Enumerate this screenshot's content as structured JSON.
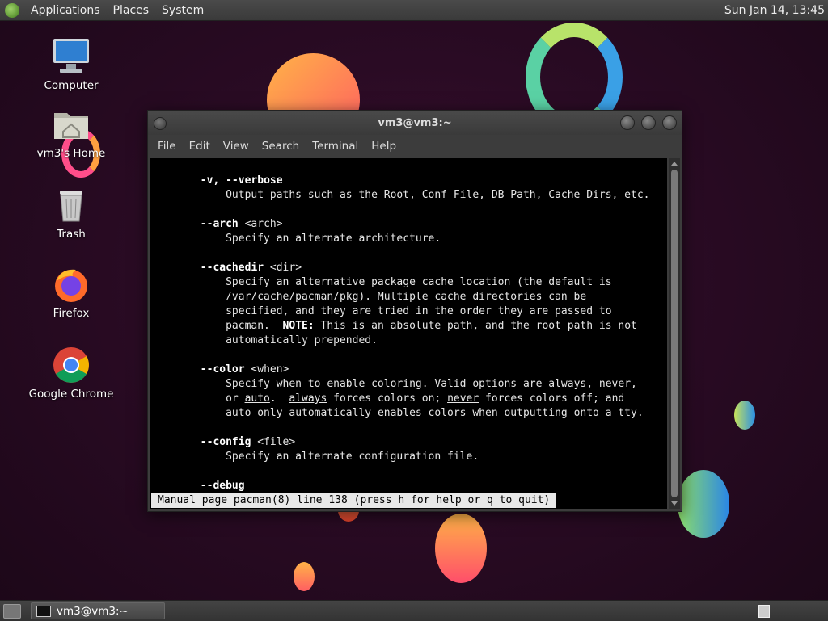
{
  "top_panel": {
    "menu": [
      "Applications",
      "Places",
      "System"
    ],
    "clock": "Sun Jan 14, 13:45"
  },
  "desktop_icons": [
    {
      "label": "Computer",
      "icon": "computer-icon"
    },
    {
      "label": "vm3's Home",
      "icon": "home-folder-icon"
    },
    {
      "label": "Trash",
      "icon": "trash-icon"
    },
    {
      "label": "Firefox",
      "icon": "firefox-icon"
    },
    {
      "label": "Google Chrome",
      "icon": "chrome-icon"
    }
  ],
  "terminal": {
    "title": "vm3@vm3:~",
    "menu": [
      "File",
      "Edit",
      "View",
      "Search",
      "Terminal",
      "Help"
    ],
    "lines": [
      [
        {
          "t": "       "
        },
        {
          "t": "-v, --verbose",
          "c": "b"
        }
      ],
      [
        {
          "t": "           Output paths such as the Root, Conf File, DB Path, Cache Dirs, etc."
        }
      ],
      [
        {
          "t": ""
        }
      ],
      [
        {
          "t": "       "
        },
        {
          "t": "--arch",
          "c": "b"
        },
        {
          "t": " <arch>"
        }
      ],
      [
        {
          "t": "           Specify an alternate architecture."
        }
      ],
      [
        {
          "t": ""
        }
      ],
      [
        {
          "t": "       "
        },
        {
          "t": "--cachedir",
          "c": "b"
        },
        {
          "t": " <dir>"
        }
      ],
      [
        {
          "t": "           Specify an alternative package cache location (the default is"
        }
      ],
      [
        {
          "t": "           /var/cache/pacman/pkg). Multiple cache directories can be"
        }
      ],
      [
        {
          "t": "           specified, and they are tried in the order they are passed to"
        }
      ],
      [
        {
          "t": "           pacman.  "
        },
        {
          "t": "NOTE:",
          "c": "b"
        },
        {
          "t": " This is an absolute path, and the root path is not"
        }
      ],
      [
        {
          "t": "           automatically prepended."
        }
      ],
      [
        {
          "t": ""
        }
      ],
      [
        {
          "t": "       "
        },
        {
          "t": "--color",
          "c": "b"
        },
        {
          "t": " <when>"
        }
      ],
      [
        {
          "t": "           Specify when to enable coloring. Valid options are "
        },
        {
          "t": "always",
          "c": "u"
        },
        {
          "t": ", "
        },
        {
          "t": "never",
          "c": "u"
        },
        {
          "t": ","
        }
      ],
      [
        {
          "t": "           or "
        },
        {
          "t": "auto",
          "c": "u"
        },
        {
          "t": ".  "
        },
        {
          "t": "always",
          "c": "u"
        },
        {
          "t": " forces colors on; "
        },
        {
          "t": "never",
          "c": "u"
        },
        {
          "t": " forces colors off; and"
        }
      ],
      [
        {
          "t": "           "
        },
        {
          "t": "auto",
          "c": "u"
        },
        {
          "t": " only automatically enables colors when outputting onto a tty."
        }
      ],
      [
        {
          "t": ""
        }
      ],
      [
        {
          "t": "       "
        },
        {
          "t": "--config",
          "c": "b"
        },
        {
          "t": " <file>"
        }
      ],
      [
        {
          "t": "           Specify an alternate configuration file."
        }
      ],
      [
        {
          "t": ""
        }
      ],
      [
        {
          "t": "       "
        },
        {
          "t": "--debug",
          "c": "b"
        }
      ]
    ],
    "status": "Manual page pacman(8) line 138 (press h for help or q to quit)"
  },
  "bottom_panel": {
    "task": "vm3@vm3:~"
  },
  "colors": {
    "background": "#2a0b24",
    "panel": "#3a3a3a",
    "terminal_bg": "#000000"
  }
}
